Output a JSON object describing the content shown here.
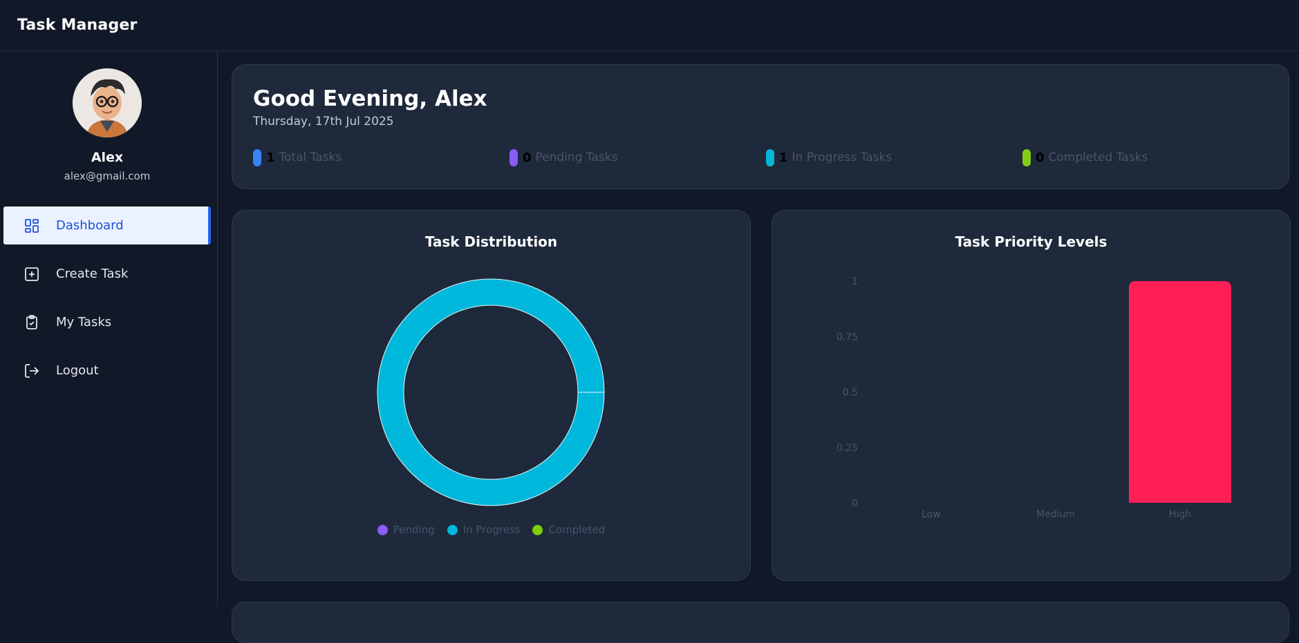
{
  "app": {
    "title": "Task Manager"
  },
  "user": {
    "name": "Alex",
    "email": "alex@gmail.com"
  },
  "nav": [
    {
      "label": "Dashboard",
      "icon": "dashboard-icon",
      "active": true
    },
    {
      "label": "Create Task",
      "icon": "plus-square-icon",
      "active": false
    },
    {
      "label": "My Tasks",
      "icon": "clipboard-check-icon",
      "active": false
    },
    {
      "label": "Logout",
      "icon": "logout-icon",
      "active": false
    }
  ],
  "greeting": {
    "title": "Good Evening, Alex",
    "date": "Thursday, 17th Jul 2025"
  },
  "stats": [
    {
      "count": "1",
      "label": "Total Tasks",
      "color": "#3b82f6"
    },
    {
      "count": "0",
      "label": "Pending Tasks",
      "color": "#8b5cf6"
    },
    {
      "count": "1",
      "label": "In Progress Tasks",
      "color": "#06b6d4"
    },
    {
      "count": "0",
      "label": "Completed Tasks",
      "color": "#84cc16"
    }
  ],
  "distribution": {
    "title": "Task Distribution",
    "chart_data": {
      "type": "pie",
      "labels": [
        "Pending",
        "In Progress",
        "Completed"
      ],
      "values": [
        0,
        1,
        0
      ],
      "colors": [
        "#8b5cf6",
        "#00b8db",
        "#7ccf00"
      ],
      "legend": "bottom"
    }
  },
  "priority": {
    "title": "Task Priority Levels",
    "chart_data": {
      "type": "bar",
      "categories": [
        "Low",
        "Medium",
        "High"
      ],
      "values": [
        0,
        0,
        1
      ],
      "ylim": [
        0,
        1
      ],
      "yticks": [
        "0",
        "0.25",
        "0.5",
        "0.75",
        "1"
      ],
      "color": "#ff1f57"
    }
  }
}
